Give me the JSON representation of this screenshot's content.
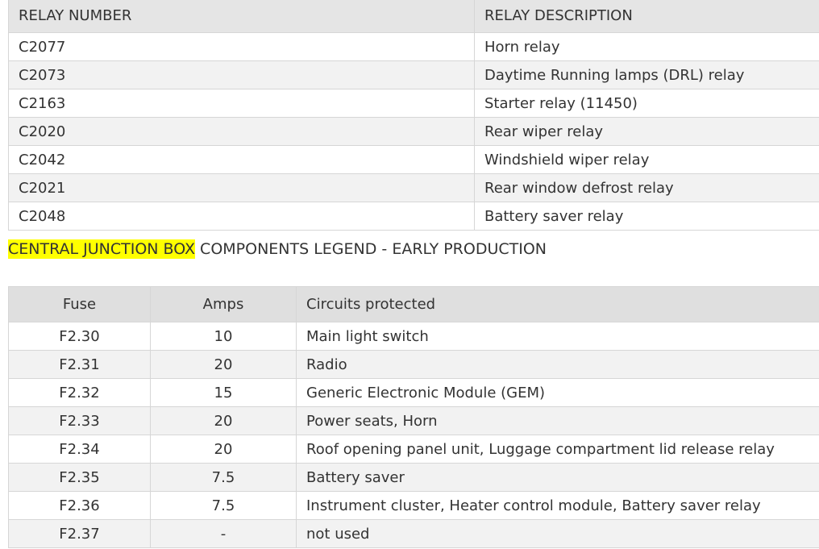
{
  "relay_table": {
    "headers": [
      "RELAY NUMBER",
      "RELAY DESCRIPTION"
    ],
    "rows": [
      [
        "C2077",
        "Horn relay"
      ],
      [
        "C2073",
        "Daytime Running lamps (DRL) relay"
      ],
      [
        "C2163",
        "Starter relay (11450)"
      ],
      [
        "C2020",
        "Rear wiper relay"
      ],
      [
        "C2042",
        "Windshield wiper relay"
      ],
      [
        "C2021",
        "Rear window defrost relay"
      ],
      [
        "C2048",
        "Battery saver relay"
      ]
    ]
  },
  "legend": {
    "highlight": "CENTRAL JUNCTION BOX",
    "rest": " COMPONENTS LEGEND - EARLY PRODUCTION",
    "highlight_color": "#ffff00"
  },
  "fuse_table": {
    "headers": [
      "Fuse",
      "Amps",
      "Circuits protected"
    ],
    "rows": [
      [
        "F2.30",
        "10",
        "Main light switch"
      ],
      [
        "F2.31",
        "20",
        "Radio"
      ],
      [
        "F2.32",
        "15",
        "Generic Electronic Module (GEM)"
      ],
      [
        "F2.33",
        "20",
        "Power seats, Horn"
      ],
      [
        "F2.34",
        "20",
        "Roof opening panel unit, Luggage compartment lid release relay"
      ],
      [
        "F2.35",
        "7.5",
        "Battery saver"
      ],
      [
        "F2.36",
        "7.5",
        "Instrument cluster, Heater control module, Battery saver relay"
      ],
      [
        "F2.37",
        "-",
        "not used"
      ]
    ]
  }
}
